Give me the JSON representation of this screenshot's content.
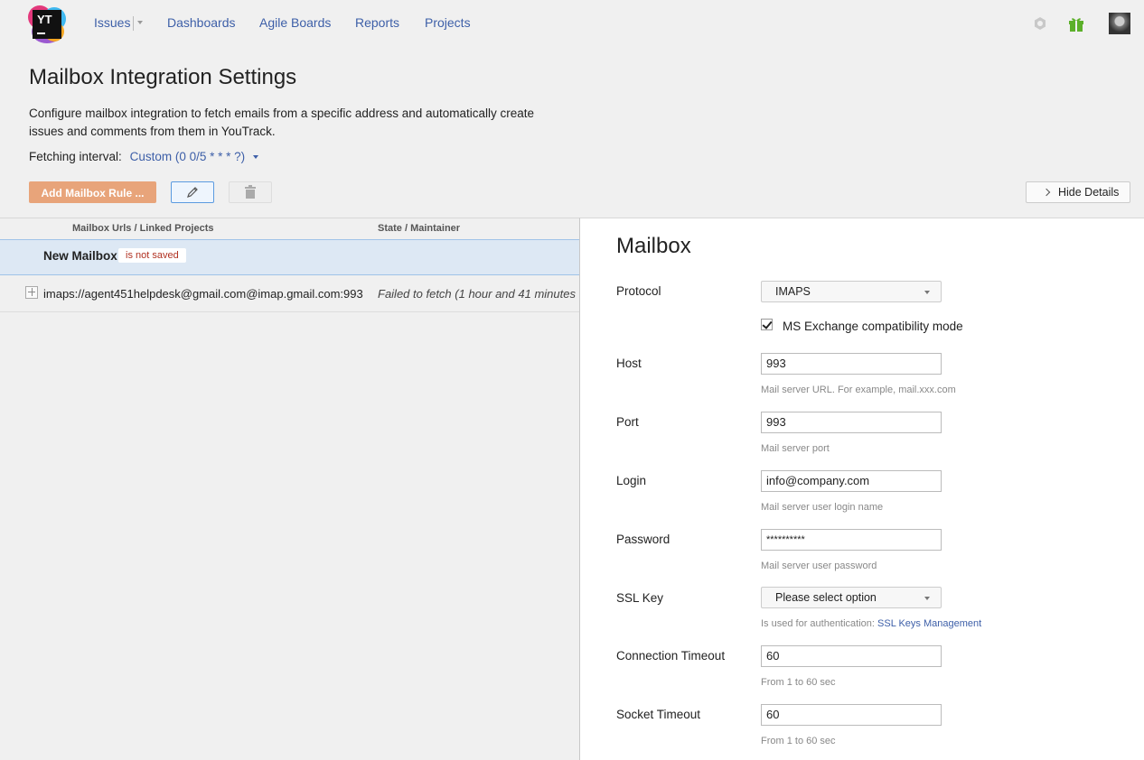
{
  "nav": {
    "logo_text": "YT",
    "items": [
      "Issues",
      "Dashboards",
      "Agile Boards",
      "Reports",
      "Projects"
    ]
  },
  "page": {
    "title": "Mailbox Integration Settings",
    "description": "Configure mailbox integration to fetch emails from a specific address and automatically create issues and comments from them in YouTrack.",
    "fetching_label": "Fetching interval:",
    "fetching_value": "Custom (0 0/5 * * * ?)"
  },
  "toolbar": {
    "add_label": "Add Mailbox Rule ...",
    "hide_details_label": "Hide Details"
  },
  "table": {
    "columns": [
      "Mailbox Urls / Linked Projects",
      "State / Maintainer"
    ],
    "new_row": {
      "name": "New Mailbox",
      "badge": "is not saved"
    },
    "rows": [
      {
        "url": "imaps://agent451helpdesk@gmail.com@imap.gmail.com:993",
        "state": "Failed to fetch (1 hour and 41 minutes"
      }
    ]
  },
  "details": {
    "title": "Mailbox",
    "protocol": {
      "label": "Protocol",
      "value": "IMAPS"
    },
    "ms_exchange": {
      "label": "MS Exchange compatibility mode",
      "checked": true
    },
    "host": {
      "label": "Host",
      "value": "993",
      "hint": "Mail server URL. For example, mail.xxx.com"
    },
    "port": {
      "label": "Port",
      "value": "993",
      "hint": "Mail server port"
    },
    "login": {
      "label": "Login",
      "value": "info@company.com",
      "hint": "Mail server user login name"
    },
    "password": {
      "label": "Password",
      "value": "**********",
      "hint": "Mail server user password"
    },
    "ssl_key": {
      "label": "SSL Key",
      "value": "Please select option",
      "hint": "Is used for authentication:",
      "hint_link": "SSL Keys Management"
    },
    "connection_timeout": {
      "label": "Connection Timeout",
      "value": "60",
      "hint": "From 1 to 60 sec"
    },
    "socket_timeout": {
      "label": "Socket Timeout",
      "value": "60",
      "hint": "From 1 to 60 sec"
    }
  },
  "colors": {
    "link": "#3d5fa8",
    "add_button": "#e8a47a",
    "selected_row": "#dde8f4",
    "badge_text": "#b03020"
  },
  "icons": [
    "settings-hex-icon",
    "gift-icon",
    "pencil-icon",
    "trash-icon",
    "chevron-right-icon",
    "expand-plus-icon"
  ]
}
